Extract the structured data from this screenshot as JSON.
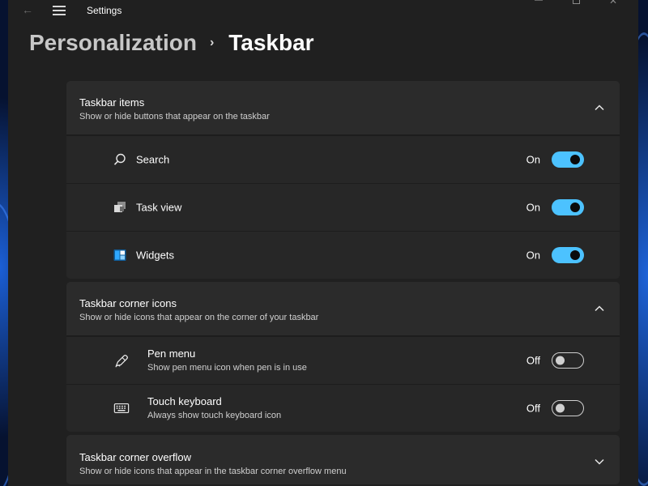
{
  "window": {
    "app_title": "Settings"
  },
  "breadcrumb": {
    "parent": "Personalization",
    "separator": "›",
    "current": "Taskbar"
  },
  "sections": [
    {
      "title": "Taskbar items",
      "description": "Show or hide buttons that appear on the taskbar",
      "expanded": true,
      "items": [
        {
          "label": "Search",
          "icon": "search-icon",
          "state_text": "On",
          "on": true
        },
        {
          "label": "Task view",
          "icon": "task-view-icon",
          "state_text": "On",
          "on": true
        },
        {
          "label": "Widgets",
          "icon": "widgets-icon",
          "state_text": "On",
          "on": true
        }
      ]
    },
    {
      "title": "Taskbar corner icons",
      "description": "Show or hide icons that appear on the corner of your taskbar",
      "expanded": true,
      "items": [
        {
          "label": "Pen menu",
          "subtitle": "Show pen menu icon when pen is in use",
          "icon": "pen-icon",
          "state_text": "Off",
          "on": false
        },
        {
          "label": "Touch keyboard",
          "subtitle": "Always show touch keyboard icon",
          "icon": "keyboard-icon",
          "state_text": "Off",
          "on": false
        }
      ]
    },
    {
      "title": "Taskbar corner overflow",
      "description": "Show or hide icons that appear in the taskbar corner overflow menu",
      "expanded": false
    }
  ],
  "colors": {
    "accent": "#4cc2ff",
    "window_bg": "#202020",
    "card_bg": "#2b2b2b"
  }
}
